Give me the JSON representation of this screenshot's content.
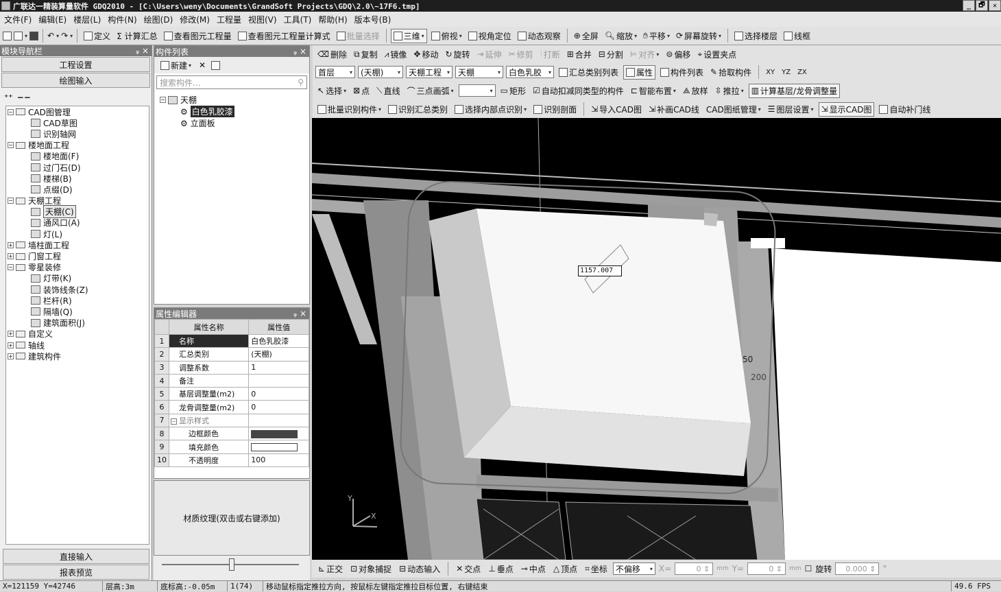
{
  "window": {
    "title": "广联达一精装算量软件 GDQ2010 - [C:\\Users\\weny\\Documents\\GrandSoft Projects\\GDQ\\2.0\\~17F6.tmp]",
    "controls": [
      "_",
      "🗗",
      "✕"
    ]
  },
  "menu": [
    "文件(F)",
    "编辑(E)",
    "楼层(L)",
    "构件(N)",
    "绘图(D)",
    "修改(M)",
    "工程量",
    "视图(V)",
    "工具(T)",
    "帮助(H)",
    "版本号(B)"
  ],
  "toolbar1": {
    "define": "定义",
    "sum": "Σ 计算汇总",
    "view_qty": "查看图元工程量",
    "view_formula": "查看图元工程量计算式",
    "batch_select": "批量选择",
    "view3d": "三维",
    "top_view": "俯视",
    "view_pos": "视角定位",
    "dyn_view": "动态观察",
    "fullscreen": "全屏",
    "zoom": "缩放",
    "pan": "平移",
    "rotate_screen": "屏幕旋转",
    "select_floor": "选择楼层",
    "wireframe": "线框"
  },
  "nav": {
    "title": "模块导航栏",
    "pin": "ᵩ",
    "close": "×",
    "btn_settings": "工程设置",
    "btn_draw": "绘图输入",
    "tree": [
      {
        "label": "CAD图管理",
        "level": 0,
        "exp": "−"
      },
      {
        "label": "CAD草图",
        "level": 1
      },
      {
        "label": "识别轴网",
        "level": 1
      },
      {
        "label": "楼地面工程",
        "level": 0,
        "exp": "−"
      },
      {
        "label": "楼地面(F)",
        "level": 1
      },
      {
        "label": "过门石(D)",
        "level": 1
      },
      {
        "label": "楼梯(B)",
        "level": 1
      },
      {
        "label": "点缀(D)",
        "level": 1
      },
      {
        "label": "天棚工程",
        "level": 0,
        "exp": "−"
      },
      {
        "label": "天棚(C)",
        "level": 1,
        "hl": true
      },
      {
        "label": "通风口(A)",
        "level": 1
      },
      {
        "label": "灯(L)",
        "level": 1
      },
      {
        "label": "墙柱面工程",
        "level": 0,
        "exp": "+"
      },
      {
        "label": "门窗工程",
        "level": 0,
        "exp": "+"
      },
      {
        "label": "零星装修",
        "level": 0,
        "exp": "−"
      },
      {
        "label": "灯带(K)",
        "level": 1
      },
      {
        "label": "装饰线条(Z)",
        "level": 1
      },
      {
        "label": "栏杆(R)",
        "level": 1
      },
      {
        "label": "隔墙(Q)",
        "level": 1
      },
      {
        "label": "建筑面积(J)",
        "level": 1
      },
      {
        "label": "自定义",
        "level": 0,
        "exp": "+"
      },
      {
        "label": "轴线",
        "level": 0,
        "exp": "+"
      },
      {
        "label": "建筑构件",
        "level": 0,
        "exp": "+"
      }
    ],
    "btn_direct": "直接输入",
    "btn_report": "报表预览"
  },
  "complist": {
    "title": "构件列表",
    "new": "新建",
    "delete": "✕",
    "search_placeholder": "搜索构件...",
    "tree_root": "天棚",
    "items": [
      "白色乳胶漆",
      "立面板"
    ]
  },
  "props": {
    "title": "属性编辑器",
    "col_name": "属性名称",
    "col_value": "属性值",
    "rows": [
      {
        "n": "1",
        "name": "名称",
        "value": "白色乳胶漆"
      },
      {
        "n": "2",
        "name": "汇总类别",
        "value": "(天棚)"
      },
      {
        "n": "3",
        "name": "调整系数",
        "value": "1"
      },
      {
        "n": "4",
        "name": "备注",
        "value": ""
      },
      {
        "n": "5",
        "name": "基层调整量(m2)",
        "value": "0"
      },
      {
        "n": "6",
        "name": "龙骨调整量(m2)",
        "value": "0"
      },
      {
        "n": "7",
        "name": "显示样式",
        "value": ""
      },
      {
        "n": "8",
        "name": "边框颜色",
        "value": ""
      },
      {
        "n": "9",
        "name": "填充颜色",
        "value": ""
      },
      {
        "n": "10",
        "name": "不透明度",
        "value": "100"
      }
    ],
    "border_color": "#444444",
    "fill_color": "#ffffff",
    "material_hint": "材质纹理(双击或右键添加)"
  },
  "toolbar2": [
    "删除",
    "复制",
    "镜像",
    "移动",
    "旋转",
    "延伸",
    "修剪",
    "打断",
    "合并",
    "分割",
    "对齐",
    "偏移",
    "设置夹点"
  ],
  "toolbar3": {
    "floor": "首层",
    "category": "(天棚)",
    "project": "天棚工程",
    "type": "天棚",
    "component": "白色乳胶",
    "summary_list": "汇总类别列表",
    "attributes": "属性",
    "comp_list": "构件列表",
    "pick": "拾取构件",
    "xy": "XY",
    "yz": "YZ",
    "zx": "ZX"
  },
  "toolbar4": {
    "select": "选择",
    "point": "点",
    "line": "直线",
    "arc3": "三点画弧",
    "rect": "矩形",
    "auto_deduct": "自动扣减同类型的构件",
    "smart_layout": "智能布置",
    "slope": "放样",
    "push_pull": "推拉",
    "calc_adjust": "计算基层/龙骨调整量"
  },
  "toolbar5": [
    "批量识别构件",
    "识别汇总类别",
    "选择内部点识别",
    "识别剖面",
    "导入CAD图",
    "补画CAD线",
    "CAD图纸管理",
    "图层设置",
    "显示CAD图",
    "自动补门线"
  ],
  "viewport": {
    "dim_input": "1157.007",
    "label_200": "200",
    "label_50": "50",
    "axis_y": "Y",
    "axis_x": "X",
    "bg_color": "#000000"
  },
  "snapbar": {
    "ortho": "正交",
    "osnap": "对象捕捉",
    "dyn_input": "动态输入",
    "intersect": "交点",
    "perp": "垂点",
    "mid": "中点",
    "vertex": "顶点",
    "coord": "坐标",
    "offset_mode": "不偏移",
    "x_label": "X=",
    "x_val": "0",
    "y_label": "Y=",
    "y_val": "0",
    "unit": "mm",
    "rotate": "旋转",
    "rotate_val": "0.000",
    "deg": "°"
  },
  "status": {
    "coords": "X=121159 Y=42746",
    "floor_h": "层高:3m",
    "base_h": "底标高:-0.05m",
    "count": "1(74)",
    "hint": "移动鼠标指定推拉方向, 按鼠标左键指定推拉目标位置, 右键结束",
    "fps": "49.6 FPS"
  }
}
